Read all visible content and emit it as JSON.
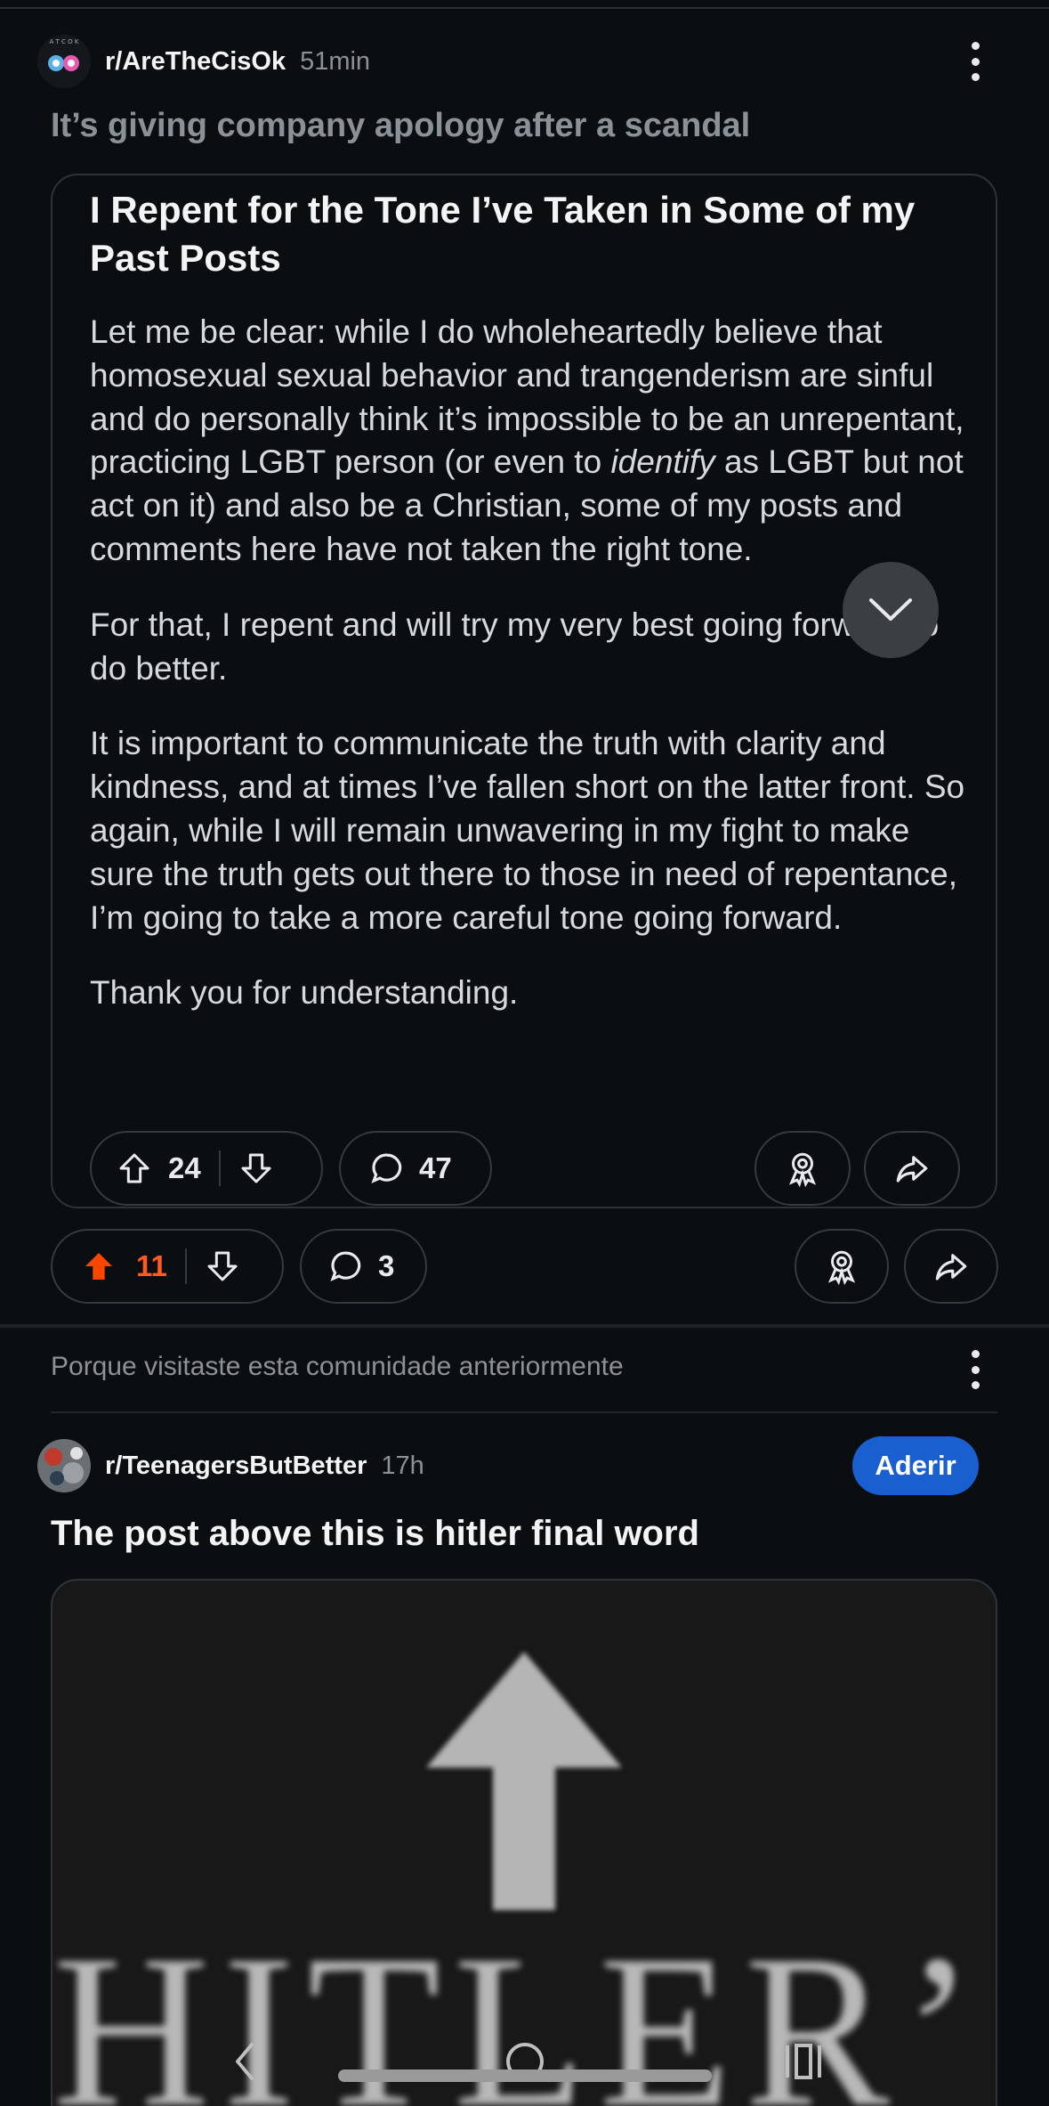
{
  "post1": {
    "subreddit": "r/AreTheCisOk",
    "time": "51min",
    "title": "It’s giving company apology after a scandal",
    "embed": {
      "title": "I Repent for the Tone I’ve Taken in Some of my Past Posts",
      "p1_a": "Let me be clear: while I do wholeheartedly believe that homosexual sexual behavior and trangenderism are sinful and do personally think it’s impossible to be an unrepentant, practicing LGBT person (or even to ",
      "p1_em": "identify",
      "p1_b": " as LGBT but not act on it) and also be a Christian, some of my posts and comments here have not taken the right tone.",
      "p2": "For that, I repent and will try my very best going forward to do better.",
      "p3": "It is important to communicate the truth with clarity and kindness, and at times I’ve fallen short on the latter front.  So again, while I will remain unwavering in my fight to make sure the truth gets out there to those in need of repentance, I’m going to take a more careful tone going forward.",
      "p4": "Thank you for understanding.",
      "votes": "24",
      "comments": "47"
    },
    "votes": "11",
    "comments": "3",
    "upvote_color": "#ff4500"
  },
  "recommendation": {
    "reason": "Porque visitaste esta comunidade anteriormente"
  },
  "post2": {
    "subreddit": "r/TeenagersButBetter",
    "time": "17h",
    "join_label": "Aderir",
    "title": "The post above this is hitler final word",
    "image_text": "HITLER’S",
    "join_color": "#1a5fd0"
  },
  "icons": [
    "kebab-menu-icon",
    "upvote-icon",
    "downvote-icon",
    "comment-icon",
    "award-icon",
    "share-icon",
    "chevron-down-icon",
    "back-icon",
    "home-icon",
    "recents-icon"
  ]
}
